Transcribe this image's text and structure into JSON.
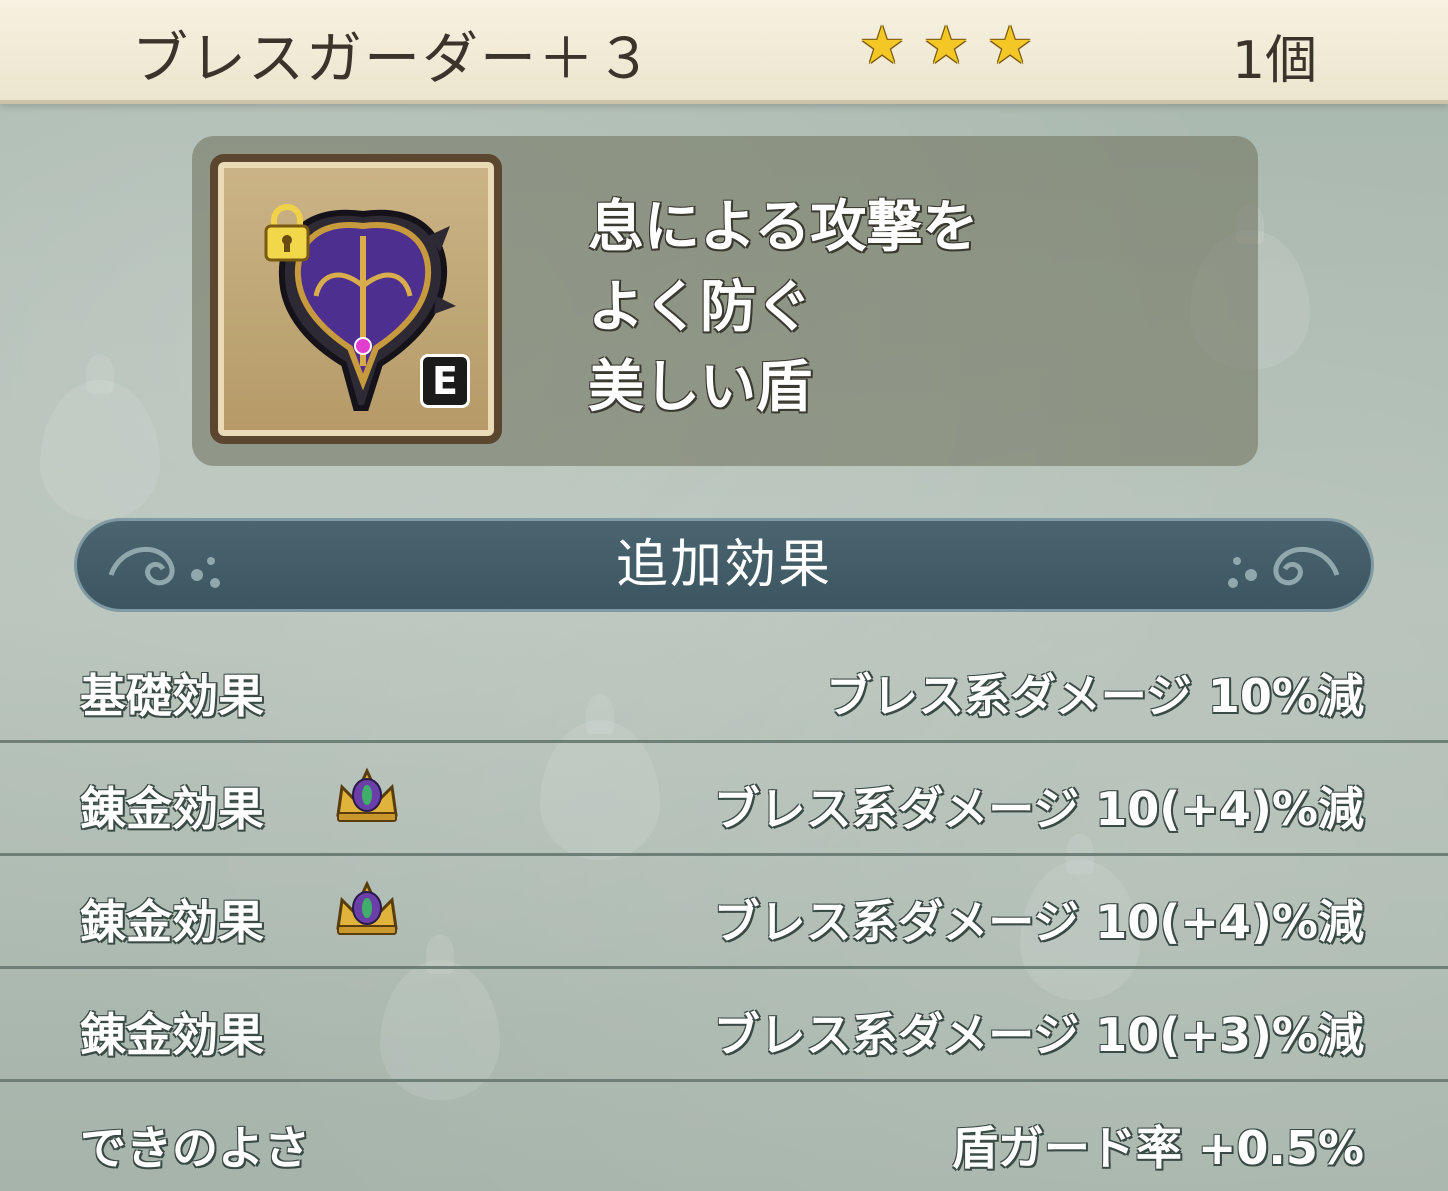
{
  "header": {
    "item_name": "ブレスガーダー＋３",
    "stars": [
      "★",
      "★",
      "★"
    ],
    "count": "1個"
  },
  "item": {
    "icon": "breath-guarder-shield-icon",
    "locked_icon": "lock-icon",
    "equipped_badge": "E",
    "description_lines": [
      "息による攻撃を",
      "よく防ぐ",
      "美しい盾"
    ]
  },
  "section": {
    "title": "追加効果"
  },
  "effects": [
    {
      "label": "基礎効果",
      "crown": false,
      "value": "ブレス系ダメージ  10%減"
    },
    {
      "label": "錬金効果",
      "crown": true,
      "value": "ブレス系ダメージ  10(+4)%減"
    },
    {
      "label": "錬金効果",
      "crown": true,
      "value": "ブレス系ダメージ  10(+4)%減"
    },
    {
      "label": "錬金効果",
      "crown": false,
      "value": "ブレス系ダメージ  10(+3)%減"
    },
    {
      "label": "できのよさ",
      "crown": false,
      "value": "盾ガード率  +0.5%"
    }
  ],
  "colors": {
    "star": "#f3c726",
    "banner": "#3b5561",
    "header_bg": "#f6f1e0"
  }
}
